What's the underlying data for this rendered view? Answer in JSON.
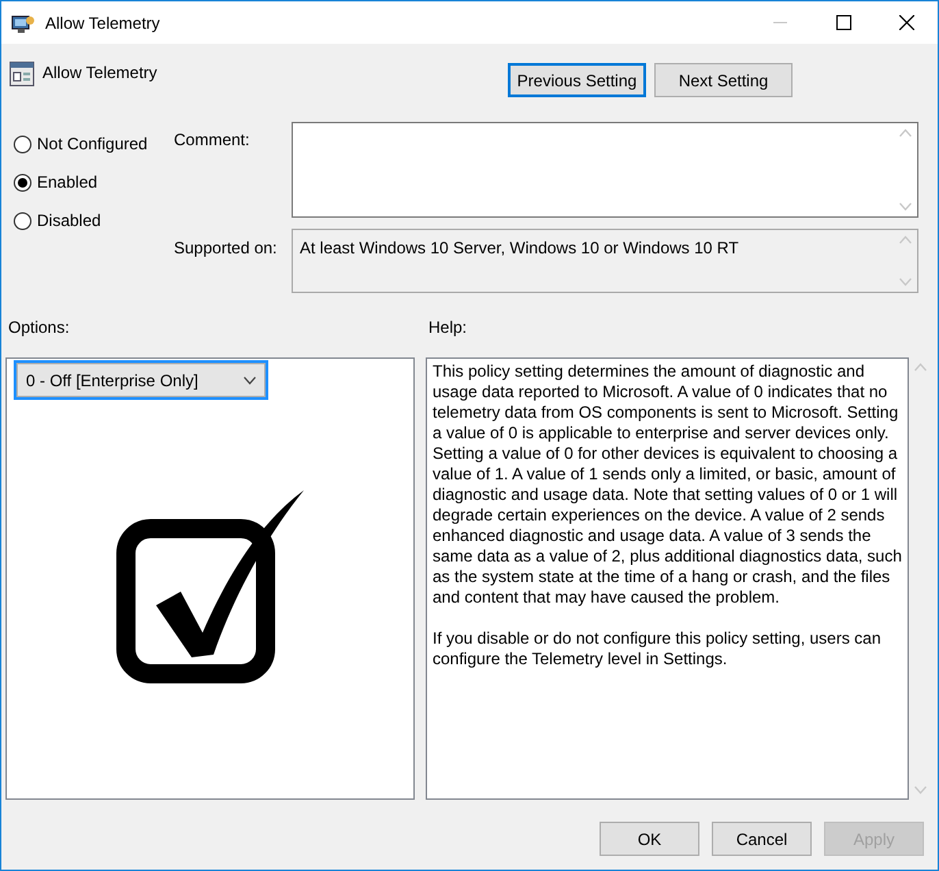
{
  "window": {
    "title": "Allow Telemetry",
    "minimize_disabled": true
  },
  "header": {
    "title": "Allow Telemetry"
  },
  "nav_buttons": [
    {
      "label": "Previous Setting",
      "focused": true
    },
    {
      "label": "Next Setting",
      "focused": false
    }
  ],
  "state_options": [
    {
      "label": "Not Configured",
      "selected": false
    },
    {
      "label": "Enabled",
      "selected": true
    },
    {
      "label": "Disabled",
      "selected": false
    }
  ],
  "comment": {
    "label": "Comment:"
  },
  "supported_on": {
    "label": "Supported on:",
    "value": "At least Windows 10 Server, Windows 10 or Windows 10 RT"
  },
  "options": {
    "label": "Options:",
    "dropdown": {
      "value": "0 - Off [Enterprise Only]",
      "focused": true
    }
  },
  "help": {
    "label": "Help:",
    "paragraphs": [
      "This policy setting determines the amount of diagnostic and usage data reported to Microsoft. A value of 0 indicates that no telemetry data from OS components is sent to Microsoft. Setting a value of 0 is applicable to enterprise and server devices only. Setting a value of 0 for other devices is equivalent to choosing a value of 1. A value of 1 sends only a limited, or basic, amount of diagnostic and usage data. Note that setting values of 0 or 1 will degrade certain experiences on the device. A value of 2 sends enhanced diagnostic and usage data. A value of 3 sends the same data as a value of 2, plus additional diagnostics data, such as the system state at the time of a hang or crash, and the files and content that may have caused the problem.",
      "If you disable or do not configure this policy setting, users can configure the Telemetry level in Settings."
    ]
  },
  "footer_buttons": [
    {
      "label": "OK",
      "disabled": false
    },
    {
      "label": "Cancel",
      "disabled": false
    },
    {
      "label": "Apply",
      "disabled": true
    }
  ]
}
